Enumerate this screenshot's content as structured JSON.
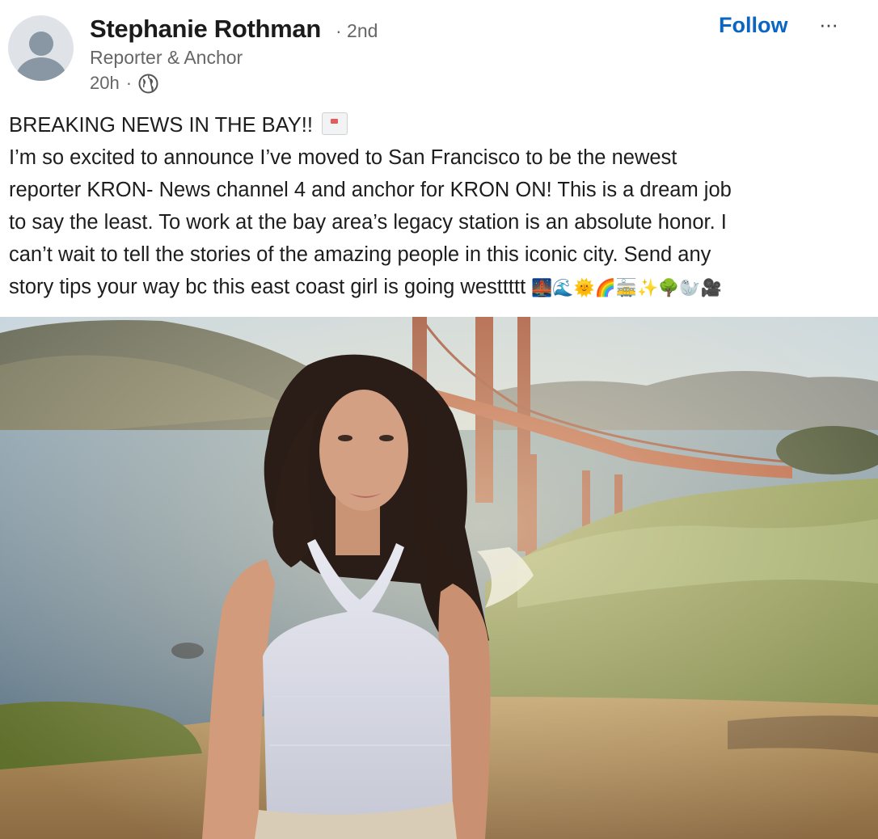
{
  "post": {
    "author": {
      "name": "Stephanie Rothman",
      "degree": "· 2nd",
      "headline": "Reporter & Anchor",
      "time": "20h",
      "time_separator": "·",
      "visibility_icon": "globe-icon"
    },
    "actions": {
      "follow_label": "Follow",
      "more_label": "···"
    },
    "text_lines": [
      "BREAKING NEWS IN THE BAY!!",
      "I’m so excited to announce I’ve moved to San Francisco to be the newest",
      "reporter KRON- News channel 4 and anchor for KRON ON! This is a dream job",
      "to say the least. To work at the bay area’s legacy station is an absolute honor. I",
      "can’t wait to tell the stories of the amazing people in this iconic city. Send any",
      "story tips your way bc this east coast girl is going westtttt"
    ],
    "trailing_emojis": "🌉🌊🌞🌈🚋✨🌳🦭🎥",
    "image": {
      "subject": "photo-of-woman-at-golden-gate-bridge"
    }
  },
  "colors": {
    "accent": "#0a66c2",
    "muted_text": "#666666",
    "primary_text": "#1d1d1d"
  }
}
